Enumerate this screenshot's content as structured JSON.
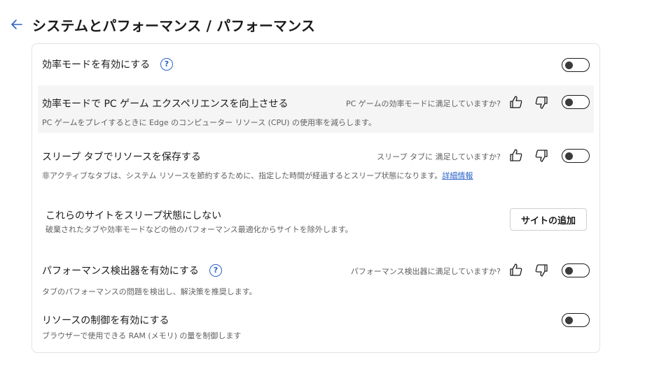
{
  "header": {
    "title": "システムとパフォーマンス / パフォーマンス",
    "back_icon": "arrow-left-icon"
  },
  "colors": {
    "accent": "#2b63c9",
    "highlight_row": "#f5f5f5",
    "toggle_off_knob": "#3b3b3b"
  },
  "settings": {
    "efficiency_mode": {
      "label": "効率モードを有効にする",
      "help": "?",
      "toggle_on": false
    },
    "gaming": {
      "label": "効率モードで PC ゲーム エクスペリエンスを向上させる",
      "question": "PC ゲームの効率モードに満足していますか?",
      "description": "PC ゲームをプレイするときに Edge のコンピューター リソース (CPU) の使用率を減らします。",
      "toggle_on": false
    },
    "sleeping_tabs": {
      "label": "スリープ タブでリソースを保存する",
      "question": "スリープ タブに 満足していますか?",
      "description": "非アクティブなタブは、システム リソースを節約するために、指定した時間が経過するとスリープ状態になります。",
      "link": "詳細情報",
      "toggle_on": false
    },
    "never_sleep": {
      "label": "これらのサイトをスリープ状態にしない",
      "description": "破棄されたタブや効率モードなどの他のパフォーマンス最適化からサイトを除外します。",
      "button": "サイトの追加"
    },
    "performance_detector": {
      "label": "パフォーマンス検出器を有効にする",
      "help": "?",
      "question": "パフォーマンス検出器に満足していますか?",
      "description": "タブのパフォーマンスの問題を検出し、解決策を推奨します。",
      "toggle_on": false
    },
    "resource_control": {
      "label": "リソースの制御を有効にする",
      "description": "ブラウザーで使用できる RAM (メモリ) の量を制御します",
      "toggle_on": false
    }
  }
}
